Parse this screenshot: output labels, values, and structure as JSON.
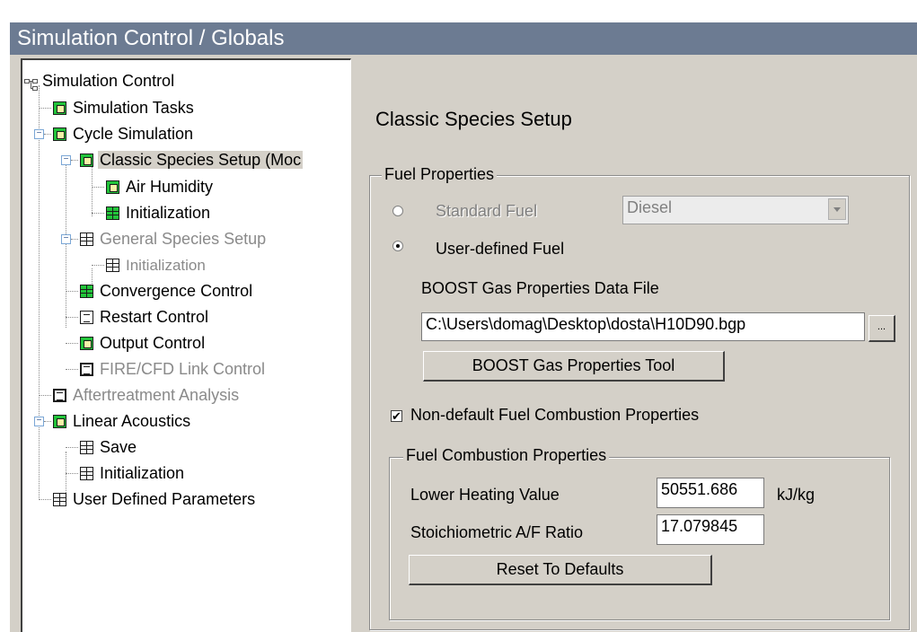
{
  "window": {
    "title": "Simulation Control / Globals"
  },
  "tree": {
    "root": "Simulation Control",
    "items": [
      {
        "label": "Simulation Tasks"
      },
      {
        "label": "Cycle Simulation"
      },
      {
        "label": "Classic Species Setup (Moc"
      },
      {
        "label": "Air Humidity"
      },
      {
        "label": "Initialization"
      },
      {
        "label": "General Species Setup"
      },
      {
        "label": "Initialization"
      },
      {
        "label": "Convergence Control"
      },
      {
        "label": "Restart Control"
      },
      {
        "label": "Output Control"
      },
      {
        "label": "FIRE/CFD Link Control"
      },
      {
        "label": "Aftertreatment Analysis"
      },
      {
        "label": "Linear Acoustics"
      },
      {
        "label": "Save"
      },
      {
        "label": "Initialization"
      },
      {
        "label": "User Defined Parameters"
      }
    ]
  },
  "main": {
    "heading": "Classic Species Setup",
    "fuel_properties": {
      "legend": "Fuel Properties",
      "standard_fuel_label": "Standard Fuel",
      "standard_fuel_value": "Diesel",
      "user_defined_label": "User-defined Fuel",
      "data_file_label": "BOOST Gas Properties Data File",
      "data_file_value": "C:\\Users\\domag\\Desktop\\dosta\\H10D90.bgp",
      "browse_label": "...",
      "tool_button": "BOOST Gas Properties Tool"
    },
    "non_default_label": "Non-default Fuel Combustion Properties",
    "combustion": {
      "legend": "Fuel Combustion Properties",
      "lhv_label": "Lower Heating Value",
      "lhv_value": "50551.686",
      "lhv_unit": "kJ/kg",
      "af_label": "Stoichiometric A/F Ratio",
      "af_value": "17.079845",
      "reset_button": "Reset To Defaults"
    }
  }
}
